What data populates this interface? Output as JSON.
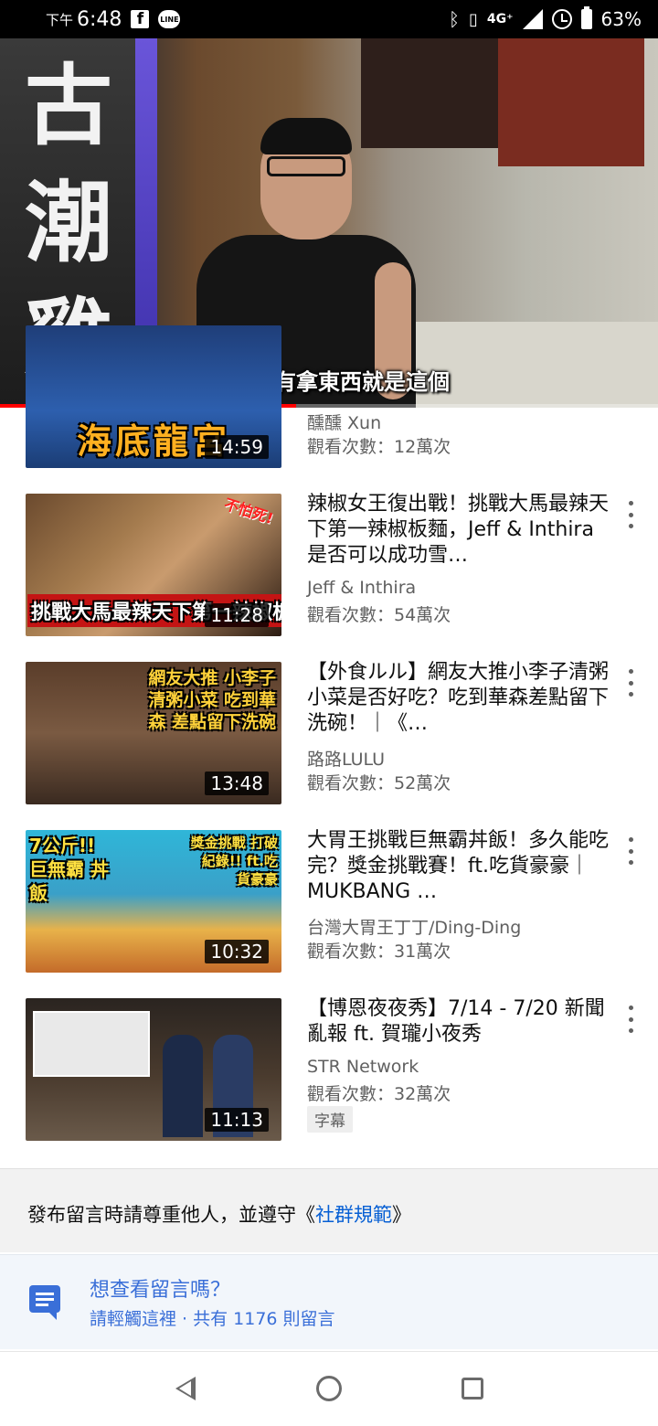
{
  "status_bar": {
    "time_prefix": "下午",
    "time": "6:48",
    "network": "4G⁺",
    "battery": "63%"
  },
  "player": {
    "subtitle": "今天手有拿東西就是這個",
    "sign_text": "古潮雞",
    "progress_fraction": 0.45
  },
  "videos": [
    {
      "thumb_text": "海底龍宮",
      "duration": "14:59",
      "title": "",
      "channel": "醺醺 Xun",
      "views": "觀看次數：12萬次"
    },
    {
      "thumb_text": "挑戰大馬最辣天下第一辣椒板麵",
      "thumb_tag": "不怕死!",
      "duration": "11:28",
      "title": "辣椒女王復出戰！挑戰大馬最辣天下第一辣椒板麵，Jeff & Inthira 是否可以成功雪…",
      "channel": "Jeff & Inthira",
      "views": "觀看次數：54萬次"
    },
    {
      "thumb_text": "網友大推 小李子清粥小菜 吃到華森 差點留下洗碗",
      "duration": "13:48",
      "title": "【外食ルル】網友大推小李子清粥小菜是否好吃？吃到華森差點留下洗碗！｜《…",
      "channel": "路路LULU",
      "views": "觀看次數：52萬次"
    },
    {
      "thumb_text": "7公斤!! 巨無霸 丼飯",
      "thumb_tag": "獎金挑戰 打破紀錄!! ft.吃貨豪豪",
      "duration": "10:32",
      "title": "大胃王挑戰巨無霸丼飯！多久能吃完？獎金挑戰賽！ft.吃貨豪豪｜MUKBANG …",
      "channel": "台灣大胃王丁丁/Ding-Ding",
      "views": "觀看次數：31萬次"
    },
    {
      "thumb_text": "",
      "duration": "11:13",
      "title": "【博恩夜夜秀】7/14 - 7/20 新聞亂報 ft. 賀瓏小夜秀",
      "channel": "STR Network",
      "views": "觀看次數：32萬次",
      "badge": "字幕"
    }
  ],
  "guideline": {
    "text": "發布留言時請尊重他人，並遵守《",
    "link": "社群規範",
    "suffix": "》"
  },
  "comments": {
    "title": "想查看留言嗎？",
    "subtitle": "請輕觸這裡 · 共有 1176 則留言"
  },
  "colors": {
    "accent_blue": "#065fd4",
    "comment_blue": "#3a6fd8",
    "progress_red": "#ff0000"
  },
  "icons": [
    "facebook-icon",
    "line-icon",
    "bluetooth-icon",
    "vibrate-icon",
    "signal-icon",
    "alarm-icon",
    "battery-icon",
    "more-vert-icon",
    "comment-icon",
    "back-icon",
    "home-icon",
    "recents-icon"
  ]
}
